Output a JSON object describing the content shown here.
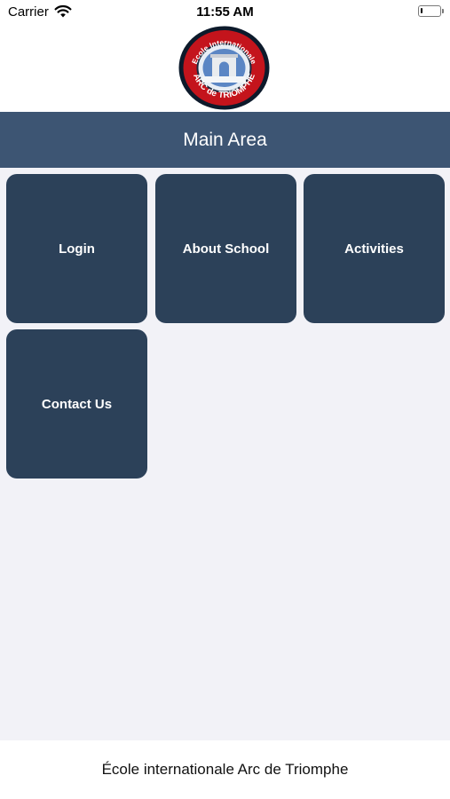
{
  "status_bar": {
    "carrier": "Carrier",
    "time": "11:55 AM",
    "wifi_icon": "wifi-icon",
    "battery_icon": "battery-icon",
    "battery_level": 0.1
  },
  "logo": {
    "icon": "school-crest-logo",
    "top_text": "Ecole Internationale",
    "bottom_text": "ARC de TRIOMPHE",
    "colors": {
      "ring": "#c4141c",
      "outer": "#0d1a2b",
      "sky": "#5b86c4"
    }
  },
  "nav": {
    "title": "Main Area",
    "background": "#3d5573"
  },
  "tiles": [
    {
      "label": "Login"
    },
    {
      "label": "About School"
    },
    {
      "label": "Activities"
    },
    {
      "label": "Contact Us"
    }
  ],
  "tile_color": "#2c4159",
  "footer": {
    "text": "École internationale Arc de Triomphe"
  }
}
